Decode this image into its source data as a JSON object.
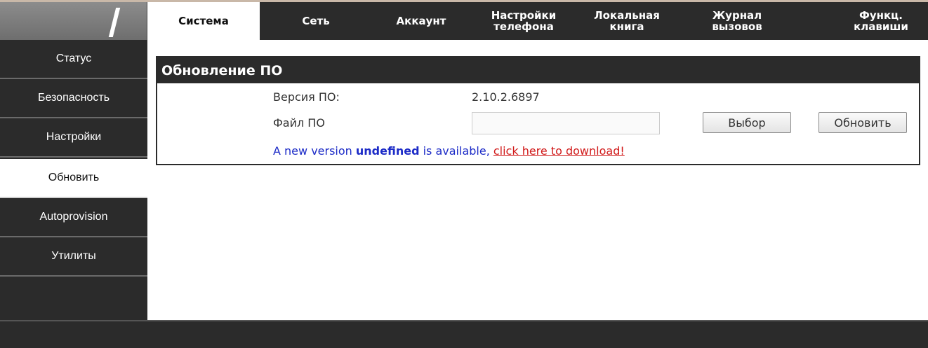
{
  "top_tabs": [
    {
      "label": "Система",
      "active": true
    },
    {
      "label": "Сеть",
      "active": false
    },
    {
      "label": "Аккаунт",
      "active": false
    },
    {
      "label": "Настройки телефона",
      "active": false
    },
    {
      "label": "Локальная книга",
      "active": false
    },
    {
      "label": "Журнал вызовов",
      "active": false
    },
    {
      "label": "Функц. клавиши",
      "active": false
    }
  ],
  "sidebar": {
    "items": [
      {
        "label": "Статус",
        "active": false
      },
      {
        "label": "Безопасность",
        "active": false
      },
      {
        "label": "Настройки",
        "active": false
      },
      {
        "label": "Обновить",
        "active": true
      },
      {
        "label": "Autoprovision",
        "active": false
      },
      {
        "label": "Утилиты",
        "active": false
      }
    ]
  },
  "panel": {
    "title": "Обновление ПО",
    "version_label": "Версия ПО:",
    "version_value": "2.10.2.6897",
    "file_label": "Файл ПО",
    "file_value": "",
    "browse_button": "Выбор",
    "update_button": "Обновить",
    "notice_prefix": "A new version ",
    "notice_version": "undefined",
    "notice_middle": " is available, ",
    "notice_link": "click here to download!"
  },
  "colors": {
    "dark_bar": "#2b2b2b",
    "notice_text": "#1c2bc7",
    "notice_link": "#d11a1a"
  }
}
